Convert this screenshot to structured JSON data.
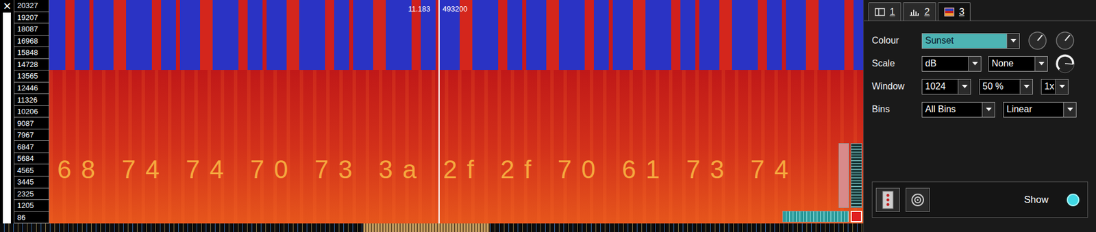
{
  "close_icon": "✕",
  "frequency_labels": [
    "20327",
    "19207",
    "18087",
    "16968",
    "15848",
    "14728",
    "13565",
    "12446",
    "11326",
    "10206",
    "9087",
    "7967",
    "6847",
    "5684",
    "4565",
    "3445",
    "2325",
    "1205",
    "86"
  ],
  "cursor": {
    "time": "11.183",
    "frame": "493200"
  },
  "spectrogram": {
    "embedded_text": "68 74 74 70 73 3a 2f 2f 70 61 73 74"
  },
  "zoom": {
    "vertical_level": 1,
    "horizontal_level": 1
  },
  "tabs": [
    {
      "label": "1",
      "selected": false
    },
    {
      "label": "2",
      "selected": false
    },
    {
      "label": "3",
      "selected": true
    }
  ],
  "rows": [
    {
      "label": "Colour",
      "items": [
        {
          "kind": "dropdown",
          "value": "Sunset",
          "highlighted": true
        },
        {
          "kind": "knob",
          "level": 0.65
        },
        {
          "kind": "knob",
          "level": 0.65
        }
      ]
    },
    {
      "label": "Scale",
      "items": [
        {
          "kind": "dropdown",
          "value": "dB",
          "highlighted": false
        },
        {
          "kind": "dropdown",
          "value": "None",
          "highlighted": false
        },
        {
          "kind": "dial",
          "level": 0.85
        }
      ]
    },
    {
      "label": "Window",
      "items": [
        {
          "kind": "dropdown",
          "value": "1024",
          "highlighted": false
        },
        {
          "kind": "dropdown",
          "value": "50 %",
          "highlighted": false
        },
        {
          "kind": "dropdown",
          "value": "1x",
          "highlighted": false
        }
      ]
    },
    {
      "label": "Bins",
      "items": [
        {
          "kind": "dropdown",
          "value": "All Bins",
          "highlighted": false
        },
        {
          "kind": "dropdown",
          "value": "Linear",
          "highlighted": false
        }
      ]
    }
  ],
  "layer": {
    "show_label": "Show",
    "show": true
  }
}
